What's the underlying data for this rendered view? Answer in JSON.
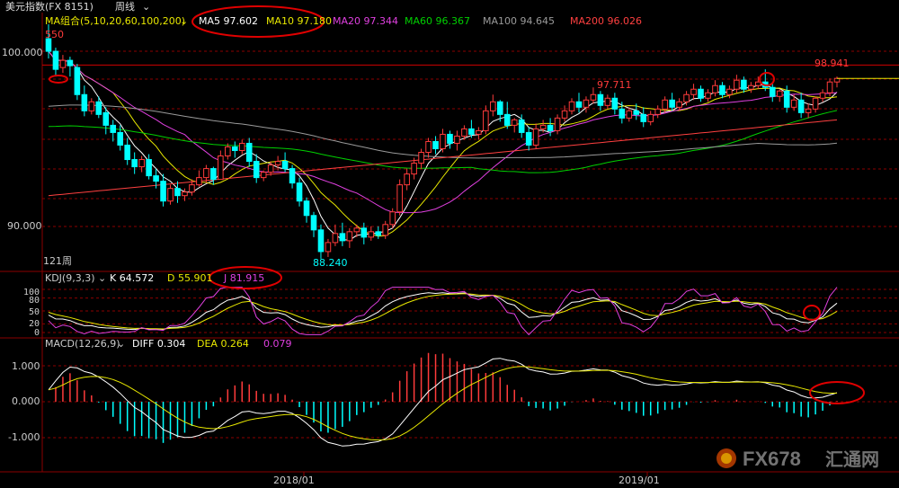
{
  "toolbar": {
    "title": "美元指数(FX 8151)",
    "period": "周线",
    "menu_chevron": "chevron-down-icon"
  },
  "main_panel": {
    "indicator_label": "MA组合(5,10,20,60,100,200)",
    "ma_readouts": [
      {
        "label": "MA5 97.602",
        "color": "#ffffff"
      },
      {
        "label": "MA10 97.180",
        "color": "#e8e800"
      },
      {
        "label": "MA20 97.344",
        "color": "#e040e0"
      },
      {
        "label": "MA60 96.367",
        "color": "#00d000"
      },
      {
        "label": "MA100 94.645",
        "color": "#9a9a9a"
      },
      {
        "label": "MA200 96.026",
        "color": "#ff4040"
      }
    ],
    "top_left_value": "550",
    "period_count": "121周",
    "y_ticks": [
      "100.000",
      "90.000"
    ],
    "annotations": {
      "high_label": "98.941",
      "mid_high_label": "97.711",
      "low_label": "88.240"
    }
  },
  "kdj_panel": {
    "label": "KDJ(9,3,3)",
    "k": "K 64.572",
    "d": "D 55.901",
    "j": "J 81.915",
    "y_ticks": [
      "100",
      "80",
      "50",
      "20",
      "0"
    ]
  },
  "macd_panel": {
    "label": "MACD(12,26,9)",
    "diff": "DIFF 0.304",
    "dea": "DEA 0.264",
    "macd": "0.079",
    "y_ticks": [
      "1.000",
      "0.000",
      "-1.000"
    ]
  },
  "x_axis": {
    "labels": [
      "2018/01",
      "2019/01"
    ]
  },
  "watermark": {
    "text_latin": "FX678",
    "text_cjk": "汇通网"
  },
  "colors": {
    "up": "#ff3b3b",
    "down": "#00ffff",
    "grid": "#8b0000",
    "axis_text": "#cccccc",
    "highlight_circle": "#e00000"
  },
  "chart_data": {
    "type": "candlestick",
    "title": "美元指数(FX 8151)",
    "period": "周线",
    "ylim": [
      87.6,
      100.8
    ],
    "price_axis_ticks": [
      100.0,
      90.0
    ],
    "annotated_levels": {
      "high": 98.941,
      "secondary_high": 97.711,
      "low": 88.24
    },
    "moving_averages_last": {
      "MA5": 97.602,
      "MA10": 97.18,
      "MA20": 97.344,
      "MA60": 96.367,
      "MA100": 94.645,
      "MA200": 96.026
    },
    "x_labels": [
      "2018/01",
      "2019/01"
    ],
    "candles": [
      {
        "o": 100.4,
        "h": 101.2,
        "c": 99.7,
        "l": 99.3
      },
      {
        "o": 99.7,
        "h": 99.9,
        "c": 98.7,
        "l": 98.3
      },
      {
        "o": 98.8,
        "h": 99.5,
        "c": 99.2,
        "l": 98.5
      },
      {
        "o": 99.2,
        "h": 99.4,
        "c": 98.9,
        "l": 98.3
      },
      {
        "o": 98.8,
        "h": 99.0,
        "c": 97.3,
        "l": 97.0
      },
      {
        "o": 97.3,
        "h": 97.8,
        "c": 96.4,
        "l": 96.1
      },
      {
        "o": 96.4,
        "h": 97.1,
        "c": 96.9,
        "l": 96.2
      },
      {
        "o": 96.9,
        "h": 97.2,
        "c": 96.2,
        "l": 96.0
      },
      {
        "o": 96.3,
        "h": 96.6,
        "c": 95.6,
        "l": 95.1
      },
      {
        "o": 95.6,
        "h": 95.9,
        "c": 95.2,
        "l": 94.7
      },
      {
        "o": 95.2,
        "h": 95.6,
        "c": 94.5,
        "l": 94.2
      },
      {
        "o": 94.5,
        "h": 94.9,
        "c": 93.7,
        "l": 93.4
      },
      {
        "o": 93.7,
        "h": 94.1,
        "c": 93.3,
        "l": 92.9
      },
      {
        "o": 93.3,
        "h": 93.9,
        "c": 93.7,
        "l": 93.0
      },
      {
        "o": 93.7,
        "h": 94.0,
        "c": 92.8,
        "l": 92.6
      },
      {
        "o": 92.8,
        "h": 93.2,
        "c": 92.5,
        "l": 92.1
      },
      {
        "o": 92.5,
        "h": 92.9,
        "c": 91.4,
        "l": 91.1
      },
      {
        "o": 91.4,
        "h": 92.3,
        "c": 92.1,
        "l": 91.2
      },
      {
        "o": 92.1,
        "h": 92.5,
        "c": 91.7,
        "l": 91.3
      },
      {
        "o": 91.7,
        "h": 92.1,
        "c": 91.9,
        "l": 91.4
      },
      {
        "o": 91.9,
        "h": 92.6,
        "c": 92.3,
        "l": 91.7
      },
      {
        "o": 92.3,
        "h": 93.1,
        "c": 92.7,
        "l": 92.2
      },
      {
        "o": 92.7,
        "h": 93.4,
        "c": 93.2,
        "l": 92.4
      },
      {
        "o": 93.2,
        "h": 93.3,
        "c": 92.6,
        "l": 92.3
      },
      {
        "o": 92.6,
        "h": 94.2,
        "c": 93.9,
        "l": 92.6
      },
      {
        "o": 93.9,
        "h": 94.6,
        "c": 94.4,
        "l": 93.7
      },
      {
        "o": 94.4,
        "h": 94.7,
        "c": 94.2,
        "l": 93.8
      },
      {
        "o": 94.2,
        "h": 94.8,
        "c": 94.6,
        "l": 94.0
      },
      {
        "o": 94.6,
        "h": 94.9,
        "c": 93.6,
        "l": 93.3
      },
      {
        "o": 93.6,
        "h": 94.0,
        "c": 92.7,
        "l": 92.4
      },
      {
        "o": 92.7,
        "h": 93.1,
        "c": 93.0,
        "l": 92.5
      },
      {
        "o": 93.0,
        "h": 93.6,
        "c": 93.4,
        "l": 92.8
      },
      {
        "o": 93.4,
        "h": 93.9,
        "c": 93.6,
        "l": 93.1
      },
      {
        "o": 93.6,
        "h": 94.1,
        "c": 93.2,
        "l": 93.0
      },
      {
        "o": 93.2,
        "h": 93.4,
        "c": 92.4,
        "l": 92.1
      },
      {
        "o": 92.4,
        "h": 92.7,
        "c": 91.4,
        "l": 91.1
      },
      {
        "o": 91.4,
        "h": 91.6,
        "c": 90.6,
        "l": 90.2
      },
      {
        "o": 90.6,
        "h": 90.8,
        "c": 89.8,
        "l": 89.4
      },
      {
        "o": 89.8,
        "h": 90.1,
        "c": 88.6,
        "l": 88.2
      },
      {
        "o": 88.6,
        "h": 89.3,
        "c": 89.1,
        "l": 88.3
      },
      {
        "o": 89.1,
        "h": 90.1,
        "c": 89.6,
        "l": 88.9
      },
      {
        "o": 89.6,
        "h": 90.2,
        "c": 89.2,
        "l": 88.9
      },
      {
        "o": 89.2,
        "h": 89.9,
        "c": 89.7,
        "l": 88.8
      },
      {
        "o": 89.7,
        "h": 90.1,
        "c": 89.9,
        "l": 89.4
      },
      {
        "o": 89.9,
        "h": 90.2,
        "c": 89.4,
        "l": 89.0
      },
      {
        "o": 89.4,
        "h": 90.0,
        "c": 89.7,
        "l": 89.2
      },
      {
        "o": 89.7,
        "h": 90.0,
        "c": 89.5,
        "l": 89.3
      },
      {
        "o": 89.5,
        "h": 90.3,
        "c": 90.1,
        "l": 89.3
      },
      {
        "o": 90.1,
        "h": 91.0,
        "c": 90.8,
        "l": 89.9
      },
      {
        "o": 90.8,
        "h": 92.6,
        "c": 92.3,
        "l": 90.6
      },
      {
        "o": 92.3,
        "h": 93.2,
        "c": 92.9,
        "l": 92.0
      },
      {
        "o": 92.9,
        "h": 93.8,
        "c": 93.5,
        "l": 92.6
      },
      {
        "o": 93.5,
        "h": 94.3,
        "c": 94.1,
        "l": 93.2
      },
      {
        "o": 94.1,
        "h": 94.9,
        "c": 94.7,
        "l": 93.8
      },
      {
        "o": 94.7,
        "h": 95.0,
        "c": 94.3,
        "l": 94.0
      },
      {
        "o": 94.3,
        "h": 95.4,
        "c": 95.1,
        "l": 94.1
      },
      {
        "o": 95.1,
        "h": 95.3,
        "c": 94.6,
        "l": 94.3
      },
      {
        "o": 94.6,
        "h": 95.3,
        "c": 95.0,
        "l": 94.2
      },
      {
        "o": 95.0,
        "h": 95.6,
        "c": 95.4,
        "l": 94.8
      },
      {
        "o": 95.4,
        "h": 95.9,
        "c": 95.1,
        "l": 94.9
      },
      {
        "o": 95.1,
        "h": 95.5,
        "c": 95.3,
        "l": 94.8
      },
      {
        "o": 95.3,
        "h": 96.7,
        "c": 96.4,
        "l": 95.1
      },
      {
        "o": 96.4,
        "h": 97.3,
        "c": 96.9,
        "l": 96.1
      },
      {
        "o": 96.9,
        "h": 97.0,
        "c": 96.2,
        "l": 95.8
      },
      {
        "o": 96.2,
        "h": 96.9,
        "c": 95.6,
        "l": 95.4
      },
      {
        "o": 95.6,
        "h": 96.0,
        "c": 95.9,
        "l": 95.2
      },
      {
        "o": 95.9,
        "h": 96.2,
        "c": 95.2,
        "l": 94.9
      },
      {
        "o": 95.2,
        "h": 95.5,
        "c": 94.5,
        "l": 94.2
      },
      {
        "o": 94.5,
        "h": 95.7,
        "c": 95.4,
        "l": 94.3
      },
      {
        "o": 95.4,
        "h": 95.9,
        "c": 95.6,
        "l": 95.2
      },
      {
        "o": 95.6,
        "h": 96.0,
        "c": 95.3,
        "l": 95.0
      },
      {
        "o": 95.3,
        "h": 96.2,
        "c": 96.0,
        "l": 95.1
      },
      {
        "o": 96.0,
        "h": 96.7,
        "c": 96.4,
        "l": 95.8
      },
      {
        "o": 96.4,
        "h": 97.1,
        "c": 96.9,
        "l": 96.2
      },
      {
        "o": 96.9,
        "h": 97.4,
        "c": 96.6,
        "l": 96.3
      },
      {
        "o": 96.6,
        "h": 97.2,
        "c": 97.0,
        "l": 96.3
      },
      {
        "o": 97.0,
        "h": 97.7,
        "c": 97.3,
        "l": 96.8
      },
      {
        "o": 97.3,
        "h": 97.5,
        "c": 96.7,
        "l": 96.4
      },
      {
        "o": 96.7,
        "h": 97.3,
        "c": 97.1,
        "l": 96.5
      },
      {
        "o": 97.1,
        "h": 97.4,
        "c": 96.5,
        "l": 96.2
      },
      {
        "o": 96.5,
        "h": 96.9,
        "c": 96.0,
        "l": 95.7
      },
      {
        "o": 96.0,
        "h": 96.6,
        "c": 96.4,
        "l": 95.8
      },
      {
        "o": 96.4,
        "h": 96.8,
        "c": 96.2,
        "l": 95.9
      },
      {
        "o": 96.2,
        "h": 96.6,
        "c": 95.8,
        "l": 95.5
      },
      {
        "o": 95.8,
        "h": 96.4,
        "c": 96.2,
        "l": 95.6
      },
      {
        "o": 96.2,
        "h": 96.7,
        "c": 96.5,
        "l": 96.0
      },
      {
        "o": 96.5,
        "h": 97.2,
        "c": 97.0,
        "l": 96.3
      },
      {
        "o": 97.0,
        "h": 97.4,
        "c": 96.6,
        "l": 96.4
      },
      {
        "o": 96.6,
        "h": 97.1,
        "c": 96.9,
        "l": 96.4
      },
      {
        "o": 96.9,
        "h": 97.5,
        "c": 97.3,
        "l": 96.7
      },
      {
        "o": 97.3,
        "h": 97.9,
        "c": 97.6,
        "l": 97.0
      },
      {
        "o": 97.6,
        "h": 97.8,
        "c": 97.1,
        "l": 96.9
      },
      {
        "o": 97.1,
        "h": 97.6,
        "c": 97.4,
        "l": 96.9
      },
      {
        "o": 97.4,
        "h": 98.1,
        "c": 97.8,
        "l": 97.2
      },
      {
        "o": 97.8,
        "h": 98.0,
        "c": 97.3,
        "l": 97.1
      },
      {
        "o": 97.3,
        "h": 97.8,
        "c": 97.6,
        "l": 97.1
      },
      {
        "o": 97.6,
        "h": 98.4,
        "c": 98.1,
        "l": 97.4
      },
      {
        "o": 98.1,
        "h": 98.3,
        "c": 97.6,
        "l": 97.4
      },
      {
        "o": 97.6,
        "h": 98.0,
        "c": 97.8,
        "l": 97.4
      },
      {
        "o": 97.8,
        "h": 98.3,
        "c": 98.0,
        "l": 97.6
      },
      {
        "o": 98.0,
        "h": 98.7,
        "c": 97.7,
        "l": 97.5
      },
      {
        "o": 97.7,
        "h": 97.9,
        "c": 97.2,
        "l": 96.9
      },
      {
        "o": 97.2,
        "h": 97.6,
        "c": 97.5,
        "l": 96.9
      },
      {
        "o": 97.5,
        "h": 97.8,
        "c": 96.6,
        "l": 96.3
      },
      {
        "o": 96.6,
        "h": 97.3,
        "c": 97.0,
        "l": 96.4
      },
      {
        "o": 97.0,
        "h": 97.4,
        "c": 96.3,
        "l": 96.0
      },
      {
        "o": 96.3,
        "h": 96.8,
        "c": 96.5,
        "l": 96.0
      },
      {
        "o": 96.5,
        "h": 97.2,
        "c": 97.1,
        "l": 96.3
      },
      {
        "o": 97.1,
        "h": 97.6,
        "c": 97.4,
        "l": 96.9
      },
      {
        "o": 97.4,
        "h": 98.2,
        "c": 98.0,
        "l": 97.2
      },
      {
        "o": 98.0,
        "h": 98.3,
        "c": 98.2,
        "l": 97.7
      }
    ],
    "kdj": {
      "k_last": 64.572,
      "d_last": 55.901,
      "j_last": 81.915,
      "ylim": [
        0,
        100
      ]
    },
    "macd": {
      "diff_last": 0.304,
      "dea_last": 0.264,
      "macd_last": 0.079,
      "ylim": [
        -1.9,
        1.4
      ]
    }
  }
}
